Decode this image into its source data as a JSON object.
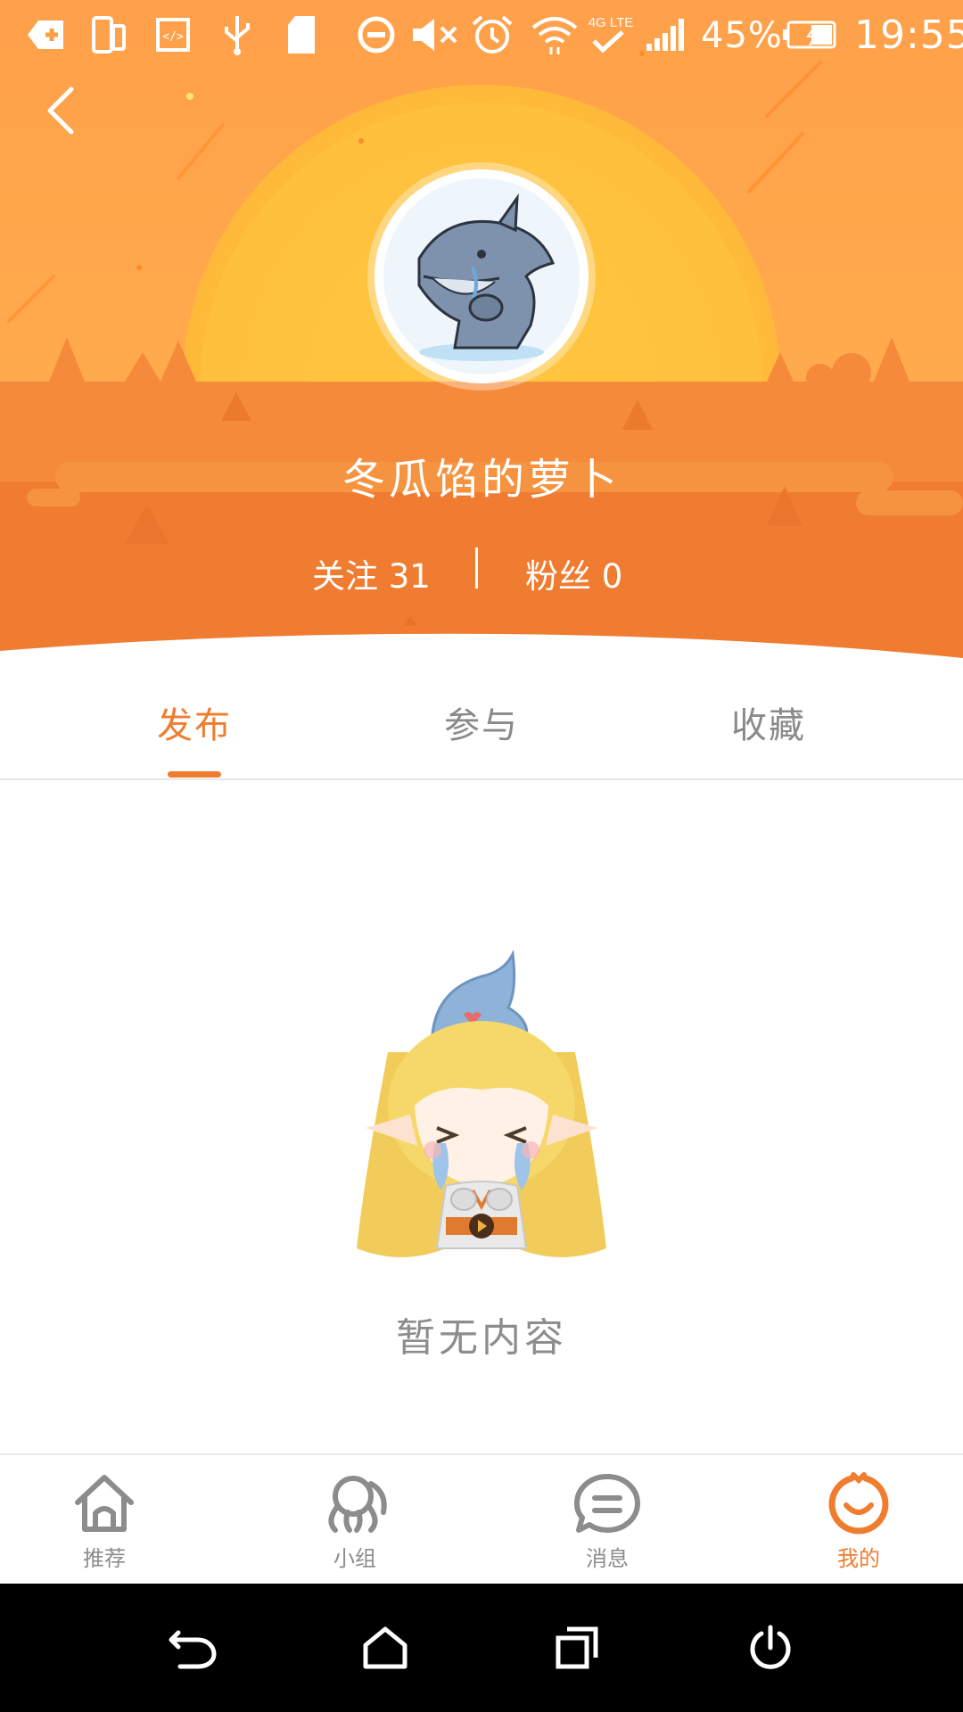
{
  "status_bar": {
    "battery_percent": "45%",
    "time": "19:55",
    "network_label": "4G LTE",
    "icons": [
      "download-icon",
      "phone-rotate-icon",
      "code-icon",
      "usb-icon",
      "sd-card-icon",
      "do-not-disturb-icon",
      "volume-mute-icon",
      "alarm-icon",
      "wifi-icon",
      "network-icon",
      "signal-icon",
      "battery-icon"
    ]
  },
  "profile": {
    "username": "冬瓜馅的萝卜",
    "follow_label": "关注 31",
    "fans_label": "粉丝 0"
  },
  "tabs": [
    {
      "label": "发布",
      "active": true
    },
    {
      "label": "参与",
      "active": false
    },
    {
      "label": "收藏",
      "active": false
    }
  ],
  "empty_state": {
    "text": "暂无内容"
  },
  "bottom_nav": [
    {
      "label": "推荐",
      "icon": "home-icon",
      "active": false
    },
    {
      "label": "小组",
      "icon": "group-icon",
      "active": false
    },
    {
      "label": "消息",
      "icon": "message-icon",
      "active": false
    },
    {
      "label": "我的",
      "icon": "me-icon",
      "active": true
    }
  ],
  "colors": {
    "accent": "#f07c2e",
    "header_orange": "#f5973f",
    "sun_yellow": "#ffc94a",
    "inactive_text": "#8a8a8a"
  }
}
